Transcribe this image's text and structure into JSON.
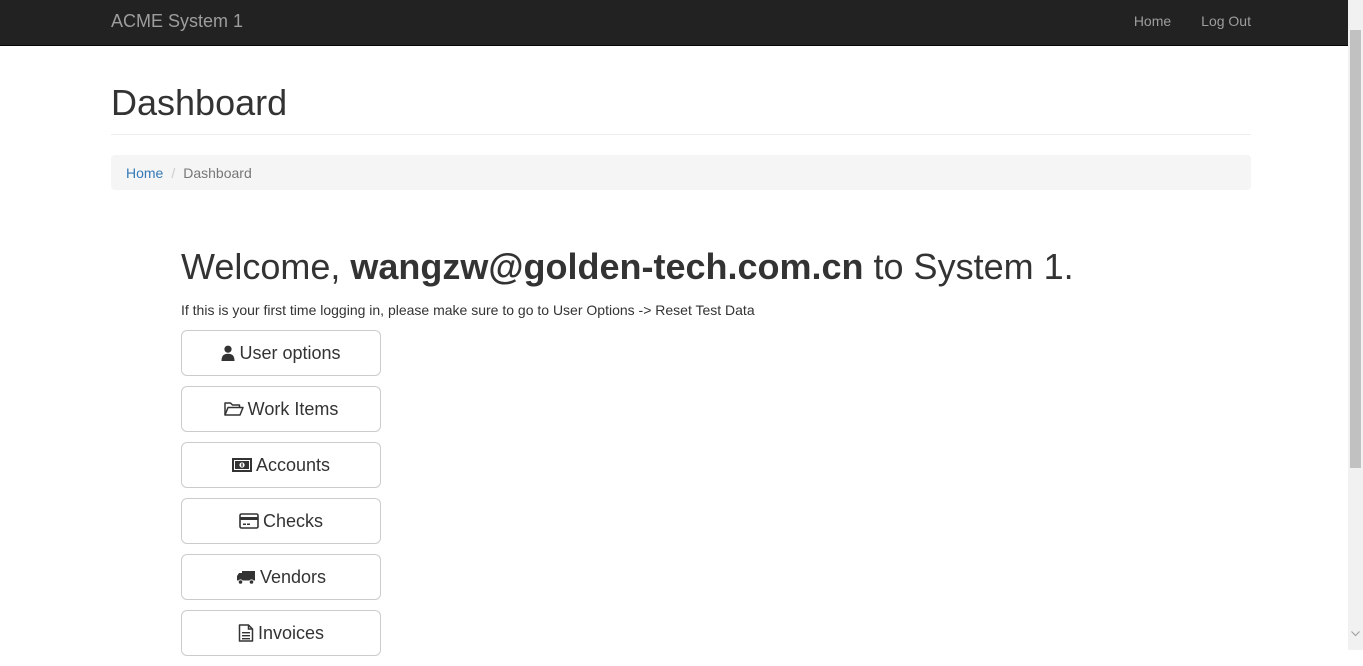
{
  "navbar": {
    "brand": "ACME System 1",
    "links": [
      "Home",
      "Log Out"
    ]
  },
  "page": {
    "title": "Dashboard"
  },
  "breadcrumb": {
    "home": "Home",
    "separator": "/",
    "current": "Dashboard"
  },
  "welcome": {
    "prefix": "Welcome, ",
    "user": "wangzw@golden-tech.com.cn",
    "suffix": " to System 1."
  },
  "hint": "If this is your first time logging in, please make sure to go to User Options -> Reset Test Data",
  "buttons": [
    {
      "label": "User options",
      "icon": "user-icon"
    },
    {
      "label": "Work Items",
      "icon": "folder-open-icon"
    },
    {
      "label": "Accounts",
      "icon": "money-icon"
    },
    {
      "label": "Checks",
      "icon": "credit-card-icon"
    },
    {
      "label": "Vendors",
      "icon": "truck-icon"
    },
    {
      "label": "Invoices",
      "icon": "file-text-icon"
    }
  ],
  "colors": {
    "navbar_bg": "#222222",
    "link": "#337ab7",
    "breadcrumb_bg": "#f5f5f5"
  }
}
